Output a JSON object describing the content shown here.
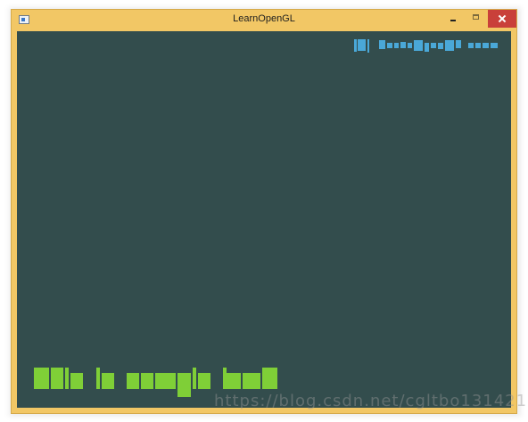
{
  "window": {
    "title": "LearnOpenGL",
    "icon": "app-window-icon",
    "controls": [
      "minimize-icon",
      "maximize-icon",
      "close-icon"
    ]
  },
  "colors": {
    "frame": "#f2c765",
    "clear_color": "#334d4d",
    "top_text_color": "#4aa8d8",
    "bottom_text_color": "#7fcf37",
    "close_button": "#c9403a"
  },
  "overlay_watermark": "https://blog.csdn.net/cgltbo131421"
}
